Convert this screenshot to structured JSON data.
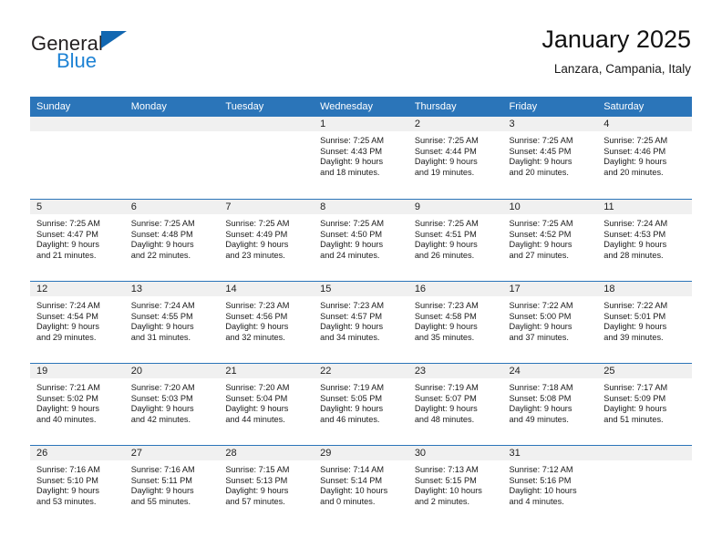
{
  "brand": {
    "name_top": "General",
    "name_bottom": "Blue",
    "triangle_color": "#1267b1",
    "blue_color": "#1d82d4"
  },
  "header": {
    "title": "January 2025",
    "subtitle": "Lanzara, Campania, Italy"
  },
  "theme": {
    "header_blue": "#2b75b9",
    "day_band_gray": "#f0f0f0",
    "text": "#1a1a1a"
  },
  "weekdays": [
    "Sunday",
    "Monday",
    "Tuesday",
    "Wednesday",
    "Thursday",
    "Friday",
    "Saturday"
  ],
  "weeks": [
    [
      {
        "day": "",
        "sunrise": "",
        "sunset": "",
        "daylight1": "",
        "daylight2": ""
      },
      {
        "day": "",
        "sunrise": "",
        "sunset": "",
        "daylight1": "",
        "daylight2": ""
      },
      {
        "day": "",
        "sunrise": "",
        "sunset": "",
        "daylight1": "",
        "daylight2": ""
      },
      {
        "day": "1",
        "sunrise": "Sunrise: 7:25 AM",
        "sunset": "Sunset: 4:43 PM",
        "daylight1": "Daylight: 9 hours",
        "daylight2": "and 18 minutes."
      },
      {
        "day": "2",
        "sunrise": "Sunrise: 7:25 AM",
        "sunset": "Sunset: 4:44 PM",
        "daylight1": "Daylight: 9 hours",
        "daylight2": "and 19 minutes."
      },
      {
        "day": "3",
        "sunrise": "Sunrise: 7:25 AM",
        "sunset": "Sunset: 4:45 PM",
        "daylight1": "Daylight: 9 hours",
        "daylight2": "and 20 minutes."
      },
      {
        "day": "4",
        "sunrise": "Sunrise: 7:25 AM",
        "sunset": "Sunset: 4:46 PM",
        "daylight1": "Daylight: 9 hours",
        "daylight2": "and 20 minutes."
      }
    ],
    [
      {
        "day": "5",
        "sunrise": "Sunrise: 7:25 AM",
        "sunset": "Sunset: 4:47 PM",
        "daylight1": "Daylight: 9 hours",
        "daylight2": "and 21 minutes."
      },
      {
        "day": "6",
        "sunrise": "Sunrise: 7:25 AM",
        "sunset": "Sunset: 4:48 PM",
        "daylight1": "Daylight: 9 hours",
        "daylight2": "and 22 minutes."
      },
      {
        "day": "7",
        "sunrise": "Sunrise: 7:25 AM",
        "sunset": "Sunset: 4:49 PM",
        "daylight1": "Daylight: 9 hours",
        "daylight2": "and 23 minutes."
      },
      {
        "day": "8",
        "sunrise": "Sunrise: 7:25 AM",
        "sunset": "Sunset: 4:50 PM",
        "daylight1": "Daylight: 9 hours",
        "daylight2": "and 24 minutes."
      },
      {
        "day": "9",
        "sunrise": "Sunrise: 7:25 AM",
        "sunset": "Sunset: 4:51 PM",
        "daylight1": "Daylight: 9 hours",
        "daylight2": "and 26 minutes."
      },
      {
        "day": "10",
        "sunrise": "Sunrise: 7:25 AM",
        "sunset": "Sunset: 4:52 PM",
        "daylight1": "Daylight: 9 hours",
        "daylight2": "and 27 minutes."
      },
      {
        "day": "11",
        "sunrise": "Sunrise: 7:24 AM",
        "sunset": "Sunset: 4:53 PM",
        "daylight1": "Daylight: 9 hours",
        "daylight2": "and 28 minutes."
      }
    ],
    [
      {
        "day": "12",
        "sunrise": "Sunrise: 7:24 AM",
        "sunset": "Sunset: 4:54 PM",
        "daylight1": "Daylight: 9 hours",
        "daylight2": "and 29 minutes."
      },
      {
        "day": "13",
        "sunrise": "Sunrise: 7:24 AM",
        "sunset": "Sunset: 4:55 PM",
        "daylight1": "Daylight: 9 hours",
        "daylight2": "and 31 minutes."
      },
      {
        "day": "14",
        "sunrise": "Sunrise: 7:23 AM",
        "sunset": "Sunset: 4:56 PM",
        "daylight1": "Daylight: 9 hours",
        "daylight2": "and 32 minutes."
      },
      {
        "day": "15",
        "sunrise": "Sunrise: 7:23 AM",
        "sunset": "Sunset: 4:57 PM",
        "daylight1": "Daylight: 9 hours",
        "daylight2": "and 34 minutes."
      },
      {
        "day": "16",
        "sunrise": "Sunrise: 7:23 AM",
        "sunset": "Sunset: 4:58 PM",
        "daylight1": "Daylight: 9 hours",
        "daylight2": "and 35 minutes."
      },
      {
        "day": "17",
        "sunrise": "Sunrise: 7:22 AM",
        "sunset": "Sunset: 5:00 PM",
        "daylight1": "Daylight: 9 hours",
        "daylight2": "and 37 minutes."
      },
      {
        "day": "18",
        "sunrise": "Sunrise: 7:22 AM",
        "sunset": "Sunset: 5:01 PM",
        "daylight1": "Daylight: 9 hours",
        "daylight2": "and 39 minutes."
      }
    ],
    [
      {
        "day": "19",
        "sunrise": "Sunrise: 7:21 AM",
        "sunset": "Sunset: 5:02 PM",
        "daylight1": "Daylight: 9 hours",
        "daylight2": "and 40 minutes."
      },
      {
        "day": "20",
        "sunrise": "Sunrise: 7:20 AM",
        "sunset": "Sunset: 5:03 PM",
        "daylight1": "Daylight: 9 hours",
        "daylight2": "and 42 minutes."
      },
      {
        "day": "21",
        "sunrise": "Sunrise: 7:20 AM",
        "sunset": "Sunset: 5:04 PM",
        "daylight1": "Daylight: 9 hours",
        "daylight2": "and 44 minutes."
      },
      {
        "day": "22",
        "sunrise": "Sunrise: 7:19 AM",
        "sunset": "Sunset: 5:05 PM",
        "daylight1": "Daylight: 9 hours",
        "daylight2": "and 46 minutes."
      },
      {
        "day": "23",
        "sunrise": "Sunrise: 7:19 AM",
        "sunset": "Sunset: 5:07 PM",
        "daylight1": "Daylight: 9 hours",
        "daylight2": "and 48 minutes."
      },
      {
        "day": "24",
        "sunrise": "Sunrise: 7:18 AM",
        "sunset": "Sunset: 5:08 PM",
        "daylight1": "Daylight: 9 hours",
        "daylight2": "and 49 minutes."
      },
      {
        "day": "25",
        "sunrise": "Sunrise: 7:17 AM",
        "sunset": "Sunset: 5:09 PM",
        "daylight1": "Daylight: 9 hours",
        "daylight2": "and 51 minutes."
      }
    ],
    [
      {
        "day": "26",
        "sunrise": "Sunrise: 7:16 AM",
        "sunset": "Sunset: 5:10 PM",
        "daylight1": "Daylight: 9 hours",
        "daylight2": "and 53 minutes."
      },
      {
        "day": "27",
        "sunrise": "Sunrise: 7:16 AM",
        "sunset": "Sunset: 5:11 PM",
        "daylight1": "Daylight: 9 hours",
        "daylight2": "and 55 minutes."
      },
      {
        "day": "28",
        "sunrise": "Sunrise: 7:15 AM",
        "sunset": "Sunset: 5:13 PM",
        "daylight1": "Daylight: 9 hours",
        "daylight2": "and 57 minutes."
      },
      {
        "day": "29",
        "sunrise": "Sunrise: 7:14 AM",
        "sunset": "Sunset: 5:14 PM",
        "daylight1": "Daylight: 10 hours",
        "daylight2": "and 0 minutes."
      },
      {
        "day": "30",
        "sunrise": "Sunrise: 7:13 AM",
        "sunset": "Sunset: 5:15 PM",
        "daylight1": "Daylight: 10 hours",
        "daylight2": "and 2 minutes."
      },
      {
        "day": "31",
        "sunrise": "Sunrise: 7:12 AM",
        "sunset": "Sunset: 5:16 PM",
        "daylight1": "Daylight: 10 hours",
        "daylight2": "and 4 minutes."
      },
      {
        "day": "",
        "sunrise": "",
        "sunset": "",
        "daylight1": "",
        "daylight2": ""
      }
    ]
  ]
}
